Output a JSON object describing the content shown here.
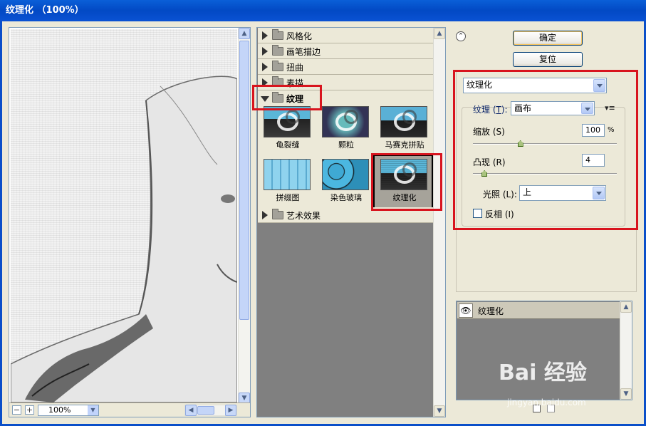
{
  "window": {
    "title": "纹理化 （100%）"
  },
  "preview": {
    "zoom": "100%"
  },
  "gallery": {
    "categories_top": [
      {
        "label": "风格化"
      },
      {
        "label": "画笔描边"
      },
      {
        "label": "扭曲"
      },
      {
        "label": "素描"
      }
    ],
    "open_category": "纹理",
    "filters": [
      {
        "label": "龟裂缝"
      },
      {
        "label": "颗粒"
      },
      {
        "label": "马赛克拼贴"
      },
      {
        "label": "拼缀图"
      },
      {
        "label": "染色玻璃"
      },
      {
        "label": "纹理化"
      }
    ],
    "categories_bottom": [
      {
        "label": "艺术效果"
      }
    ]
  },
  "buttons": {
    "ok": "确定",
    "reset": "复位"
  },
  "settings": {
    "filter_select": "纹理化",
    "texture_label_pre": "纹理 (",
    "texture_label_key": "T",
    "texture_label_post": "):",
    "texture_value": "画布",
    "scaling_label": "缩放 (S)",
    "scaling_value": "100",
    "scaling_unit": "%",
    "scaling_fraction": 0.33,
    "relief_label": "凸现 (R)",
    "relief_value": "4",
    "relief_fraction": 0.08,
    "light_label": "光照 (L):",
    "light_value": "上",
    "invert_label": "反相 (I)",
    "invert_checked": false
  },
  "layers": {
    "items": [
      {
        "label": "纹理化"
      }
    ]
  },
  "watermark": {
    "brand": "Bai 经验",
    "url": "jingyan.baidu.com"
  },
  "colors": {
    "highlight_border": "#d8141e",
    "title_bar": "#0a52d3"
  }
}
